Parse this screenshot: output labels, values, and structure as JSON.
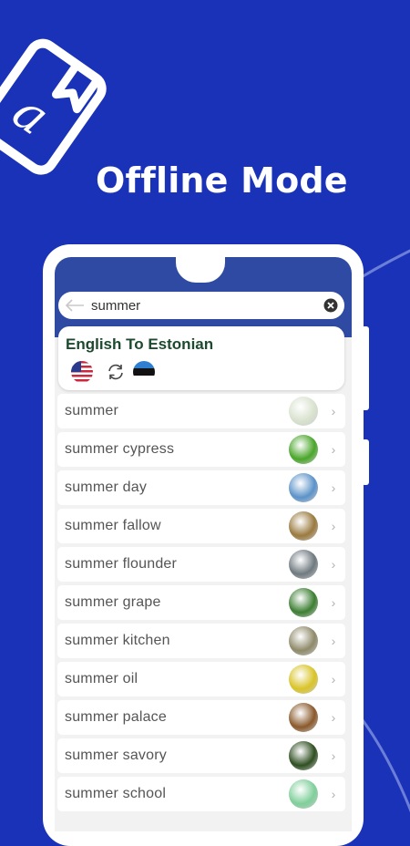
{
  "headline": "Offline Mode",
  "search": {
    "value": "summer",
    "back_icon": "arrow-left-icon",
    "clear_icon": "close-circle-icon"
  },
  "language_card": {
    "title": "English To Estonian",
    "source_flag": "us-flag-icon",
    "swap_icon": "swap-icon",
    "target_flag": "estonia-flag-icon"
  },
  "results": [
    {
      "label": "summer",
      "thumb": "#d9e2cf"
    },
    {
      "label": "summer cypress",
      "thumb": "#4aa62a"
    },
    {
      "label": "summer day",
      "thumb": "#5c93c9"
    },
    {
      "label": "summer fallow",
      "thumb": "#9a7a3f"
    },
    {
      "label": "summer flounder",
      "thumb": "#6f7a80"
    },
    {
      "label": "summer grape",
      "thumb": "#3d7f33"
    },
    {
      "label": "summer kitchen",
      "thumb": "#8f8a6a"
    },
    {
      "label": "summer oil",
      "thumb": "#d9c428"
    },
    {
      "label": "summer palace",
      "thumb": "#8a5a2c"
    },
    {
      "label": "summer savory",
      "thumb": "#2f4f22"
    },
    {
      "label": "summer school",
      "thumb": "#7fcf9a"
    }
  ],
  "colors": {
    "background": "#1a32b8",
    "app_bar": "#2e4aa3",
    "title_green": "#1d4a2e"
  }
}
